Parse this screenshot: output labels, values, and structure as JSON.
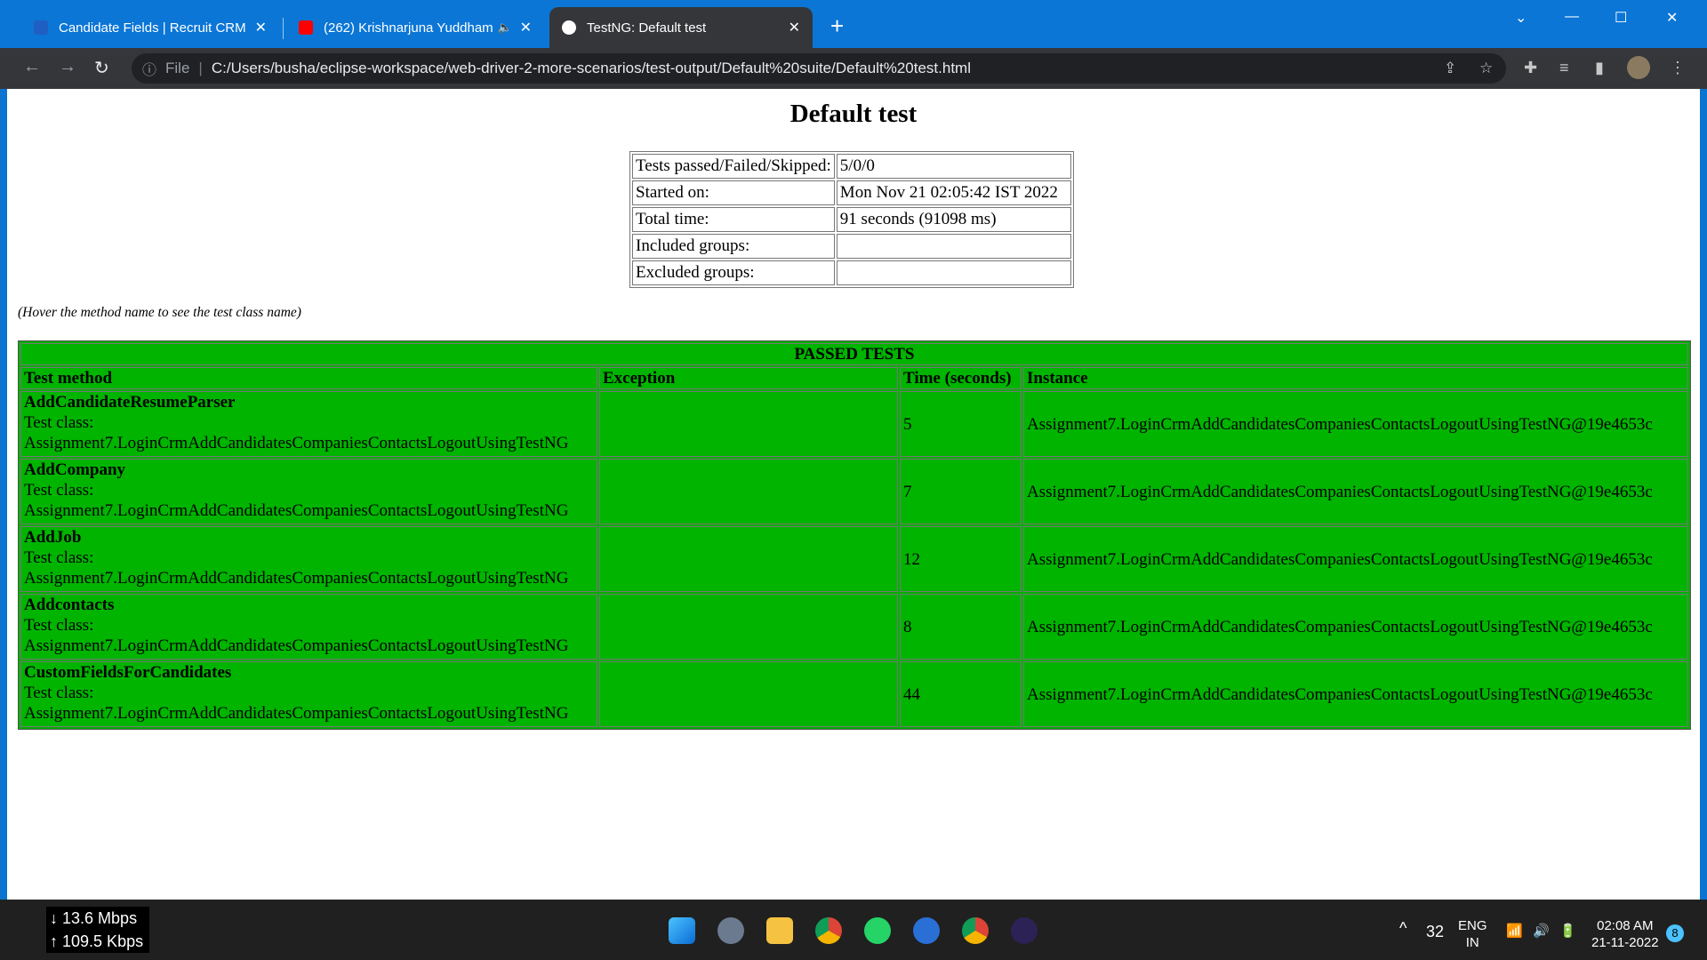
{
  "browser": {
    "tabs": [
      {
        "title": "Candidate Fields | Recruit CRM",
        "icon": "recruitcrm-icon",
        "active": false
      },
      {
        "title": "(262) Krishnarjuna Yuddham",
        "icon": "youtube-icon",
        "active": false,
        "audio": true
      },
      {
        "title": "TestNG: Default test",
        "icon": "globe-icon",
        "active": true
      }
    ],
    "address": {
      "scheme_label": "File",
      "url": "C:/Users/busha/eclipse-workspace/web-driver-2-more-scenarios/test-output/Default%20suite/Default%20test.html"
    }
  },
  "page": {
    "title": "Default test",
    "summary": [
      {
        "label": "Tests passed/Failed/Skipped:",
        "value": "5/0/0"
      },
      {
        "label": "Started on:",
        "value": "Mon Nov 21 02:05:42 IST 2022"
      },
      {
        "label": "Total time:",
        "value": "91 seconds (91098 ms)"
      },
      {
        "label": "Included groups:",
        "value": ""
      },
      {
        "label": "Excluded groups:",
        "value": ""
      }
    ],
    "note": "(Hover the method name to see the test class name)",
    "passed": {
      "caption": "PASSED TESTS",
      "headers": [
        "Test method",
        "Exception",
        "Time (seconds)",
        "Instance"
      ],
      "class_label": "Test class:",
      "color": "#00b400",
      "rows": [
        {
          "method": "AddCandidateResumeParser",
          "class": "Assignment7.LoginCrmAddCandidatesCompaniesContactsLogoutUsingTestNG",
          "exception": "",
          "time": "5",
          "instance": "Assignment7.LoginCrmAddCandidatesCompaniesContactsLogoutUsingTestNG@19e4653c"
        },
        {
          "method": "AddCompany",
          "class": "Assignment7.LoginCrmAddCandidatesCompaniesContactsLogoutUsingTestNG",
          "exception": "",
          "time": "7",
          "instance": "Assignment7.LoginCrmAddCandidatesCompaniesContactsLogoutUsingTestNG@19e4653c"
        },
        {
          "method": "AddJob",
          "class": "Assignment7.LoginCrmAddCandidatesCompaniesContactsLogoutUsingTestNG",
          "exception": "",
          "time": "12",
          "instance": "Assignment7.LoginCrmAddCandidatesCompaniesContactsLogoutUsingTestNG@19e4653c"
        },
        {
          "method": "Addcontacts",
          "class": "Assignment7.LoginCrmAddCandidatesCompaniesContactsLogoutUsingTestNG",
          "exception": "",
          "time": "8",
          "instance": "Assignment7.LoginCrmAddCandidatesCompaniesContactsLogoutUsingTestNG@19e4653c"
        },
        {
          "method": "CustomFieldsForCandidates",
          "class": "Assignment7.LoginCrmAddCandidatesCompaniesContactsLogoutUsingTestNG",
          "exception": "",
          "time": "44",
          "instance": "Assignment7.LoginCrmAddCandidatesCompaniesContactsLogoutUsingTestNG@19e4653c"
        }
      ]
    }
  },
  "taskbar": {
    "net_down": "13.6 Mbps",
    "net_up": "109.5 Kbps",
    "temp": "32",
    "lang1": "ENG",
    "lang2": "IN",
    "time": "02:08 AM",
    "date": "21-11-2022",
    "notifications": "8"
  }
}
